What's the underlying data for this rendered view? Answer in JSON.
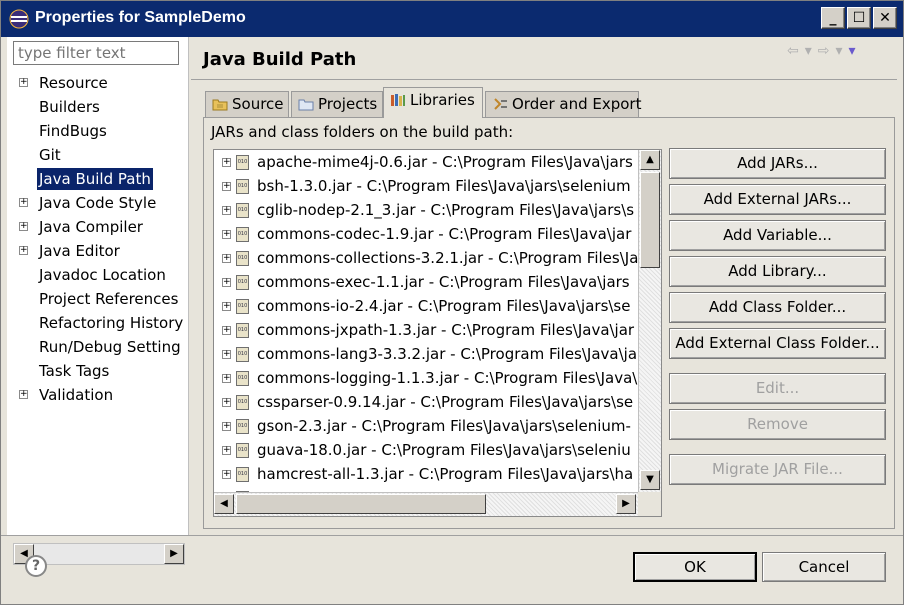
{
  "window": {
    "title": "Properties for SampleDemo",
    "minimize_label": "_",
    "maximize_label": "☐",
    "close_label": "✕"
  },
  "sidebar": {
    "filter_placeholder": "type filter text",
    "items": [
      {
        "label": "Resource",
        "expandable": true
      },
      {
        "label": "Builders",
        "expandable": false
      },
      {
        "label": "FindBugs",
        "expandable": false
      },
      {
        "label": "Git",
        "expandable": false
      },
      {
        "label": "Java Build Path",
        "expandable": false,
        "selected": true
      },
      {
        "label": "Java Code Style",
        "expandable": true
      },
      {
        "label": "Java Compiler",
        "expandable": true
      },
      {
        "label": "Java Editor",
        "expandable": true
      },
      {
        "label": "Javadoc Location",
        "expandable": false
      },
      {
        "label": "Project References",
        "expandable": false
      },
      {
        "label": "Refactoring History",
        "expandable": false
      },
      {
        "label": "Run/Debug Setting",
        "expandable": false
      },
      {
        "label": "Task Tags",
        "expandable": false
      },
      {
        "label": "Validation",
        "expandable": true
      }
    ]
  },
  "main": {
    "title": "Java Build Path",
    "tabs": [
      {
        "label": "Source",
        "icon": "source-folder-icon"
      },
      {
        "label": "Projects",
        "icon": "projects-icon"
      },
      {
        "label": "Libraries",
        "icon": "libraries-icon",
        "active": true
      },
      {
        "label": "Order and Export",
        "icon": "order-export-icon"
      }
    ],
    "list_label": "JARs and class folders on the build path:",
    "jars": [
      "apache-mime4j-0.6.jar - C:\\Program Files\\Java\\jars",
      "bsh-1.3.0.jar - C:\\Program Files\\Java\\jars\\selenium",
      "cglib-nodep-2.1_3.jar - C:\\Program Files\\Java\\jars\\s",
      "commons-codec-1.9.jar - C:\\Program Files\\Java\\jar",
      "commons-collections-3.2.1.jar - C:\\Program Files\\Ja",
      "commons-exec-1.1.jar - C:\\Program Files\\Java\\jars",
      "commons-io-2.4.jar - C:\\Program Files\\Java\\jars\\se",
      "commons-jxpath-1.3.jar - C:\\Program Files\\Java\\jar",
      "commons-lang3-3.3.2.jar - C:\\Program Files\\Java\\ja",
      "commons-logging-1.1.3.jar - C:\\Program Files\\Java\\",
      "cssparser-0.9.14.jar - C:\\Program Files\\Java\\jars\\se",
      "gson-2.3.jar - C:\\Program Files\\Java\\jars\\selenium-",
      "guava-18.0.jar - C:\\Program Files\\Java\\jars\\seleniu",
      "hamcrest-all-1.3.jar - C:\\Program Files\\Java\\jars\\ha"
    ],
    "buttons": [
      {
        "label": "Add JARs...",
        "enabled": true
      },
      {
        "label": "Add External JARs...",
        "enabled": true
      },
      {
        "label": "Add Variable...",
        "enabled": true
      },
      {
        "label": "Add Library...",
        "enabled": true
      },
      {
        "label": "Add Class Folder...",
        "enabled": true
      },
      {
        "label": "Add External Class Folder...",
        "enabled": true
      },
      {
        "label": "Edit...",
        "enabled": false
      },
      {
        "label": "Remove",
        "enabled": false
      },
      {
        "label": "Migrate JAR File...",
        "enabled": false
      }
    ]
  },
  "footer": {
    "help_label": "?",
    "ok_label": "OK",
    "cancel_label": "Cancel"
  }
}
